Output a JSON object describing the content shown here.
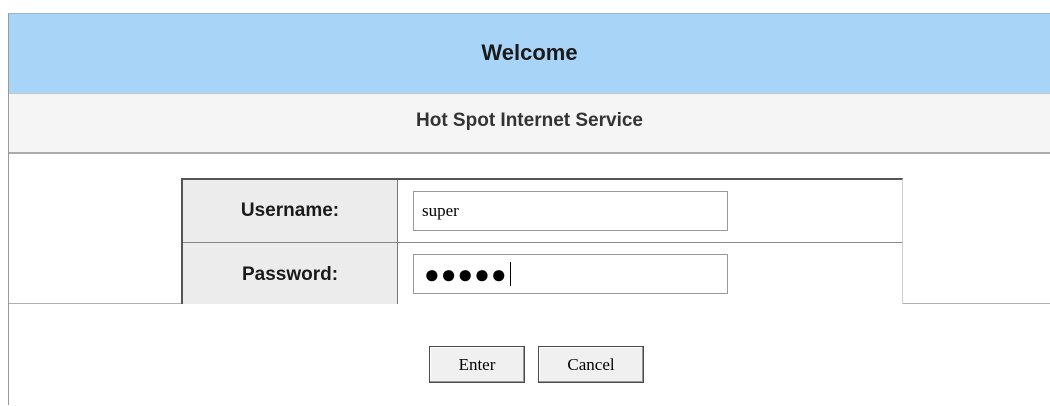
{
  "header": {
    "title": "Welcome",
    "background_color": "#a8d4f8"
  },
  "subtitle": {
    "text": "Hot Spot Internet Service"
  },
  "login_form": {
    "username_label": "Username:",
    "username_value": "super",
    "password_label": "Password:",
    "password_masked": "●●●●●"
  },
  "buttons": {
    "enter_label": "Enter",
    "cancel_label": "Cancel"
  }
}
